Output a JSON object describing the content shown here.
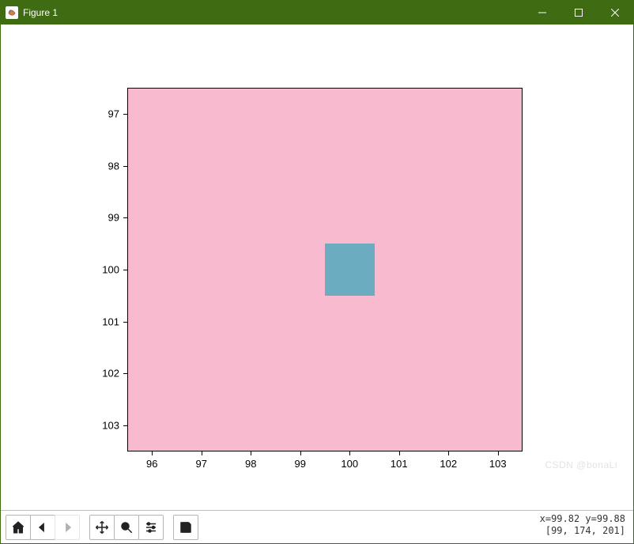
{
  "window": {
    "title": "Figure 1",
    "controls": {
      "minimize": "minimize-icon",
      "maximize": "maximize-icon",
      "close": "close-icon"
    }
  },
  "chart_data": {
    "type": "heatmap",
    "title": "",
    "xlabel": "",
    "ylabel": "",
    "x_ticks": [
      96,
      97,
      98,
      99,
      100,
      101,
      102,
      103
    ],
    "y_ticks": [
      97,
      98,
      99,
      100,
      101,
      102,
      103
    ],
    "xlim": [
      95.5,
      103.5
    ],
    "ylim": [
      103.5,
      96.5
    ],
    "background_color": "#f7bace",
    "patches": [
      {
        "x0": 99.5,
        "x1": 100.5,
        "y0": 99.5,
        "y1": 100.5,
        "color": "#6bacc0"
      }
    ]
  },
  "toolbar": {
    "home": "Home",
    "back": "Back",
    "forward": "Forward",
    "pan": "Pan",
    "zoom": "Zoom",
    "configure": "Configure subplots",
    "save": "Save"
  },
  "status": {
    "coords": "x=99.82  y=99.88",
    "pixel": "[99, 174,  201]"
  },
  "watermark": "CSDN @bonaLi"
}
